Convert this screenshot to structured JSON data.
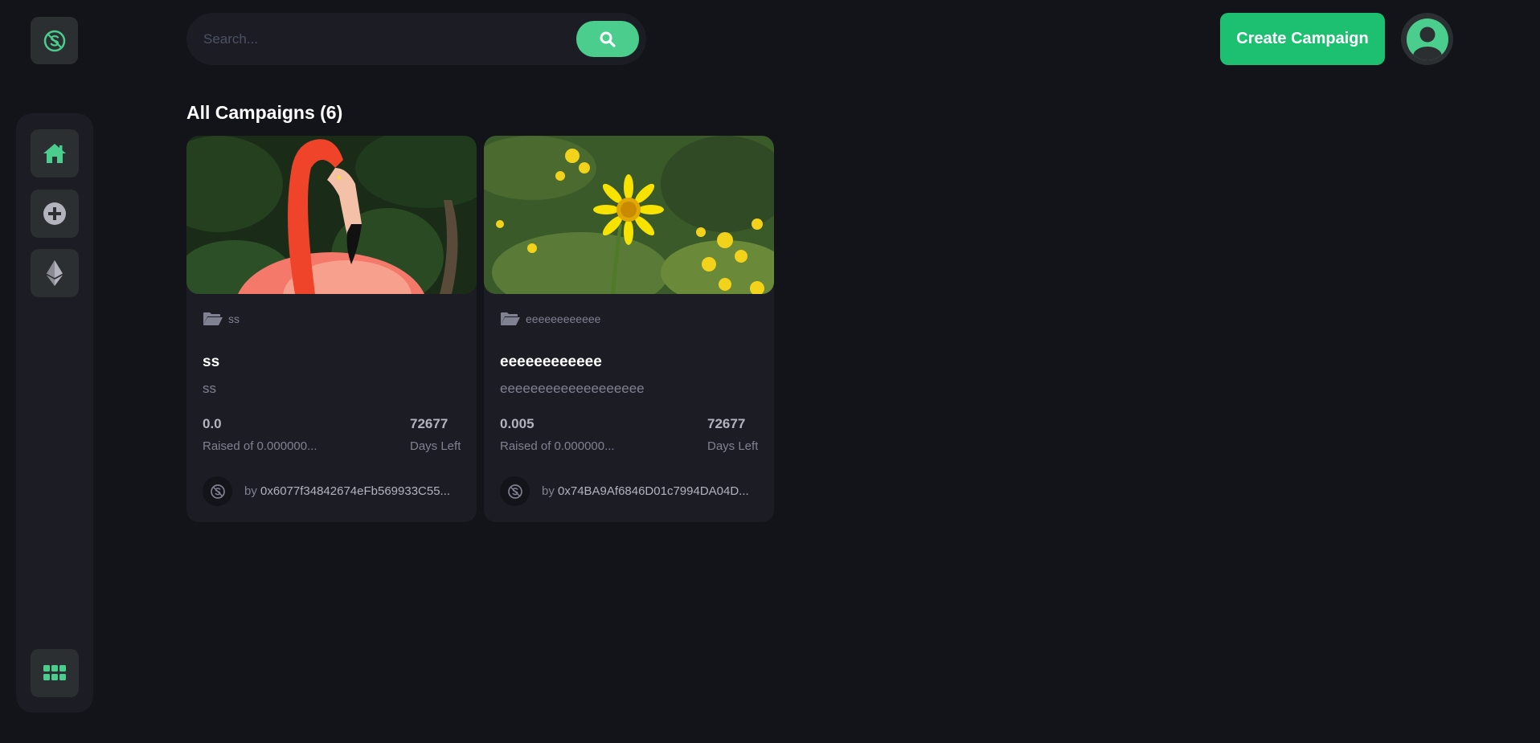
{
  "search": {
    "placeholder": "Search..."
  },
  "header": {
    "create_button_label": "Create Campaign"
  },
  "colors": {
    "accent": "#4acd8d",
    "button": "#1dc071",
    "background": "#13131a",
    "card": "#1c1c24"
  },
  "sidebar": {
    "items": [
      {
        "icon": "home-icon",
        "active": true
      },
      {
        "icon": "plus-circle-icon",
        "active": false
      },
      {
        "icon": "ethereum-icon",
        "active": false
      },
      {
        "icon": "grid-icon",
        "active": false
      }
    ]
  },
  "main": {
    "heading": "All Campaigns (6)",
    "campaigns": [
      {
        "image": "flamingo-photo",
        "category": "ss",
        "title": "ss",
        "description": "ss",
        "raised": "0.0",
        "raised_label": "Raised of 0.000000...",
        "days_left": "72677",
        "days_label": "Days Left",
        "owner_prefix": "by",
        "owner": "0x6077f34842674eFb569933C55..."
      },
      {
        "image": "yellow-daisy-photo",
        "category": "eeeeeeeeeeee",
        "title": "eeeeeeeeeeee",
        "description": "eeeeeeeeeeeeeeeeeee",
        "raised": "0.005",
        "raised_label": "Raised of 0.000000...",
        "days_left": "72677",
        "days_label": "Days Left",
        "owner_prefix": "by",
        "owner": "0x74BA9Af6846D01c7994DA04D..."
      }
    ]
  }
}
